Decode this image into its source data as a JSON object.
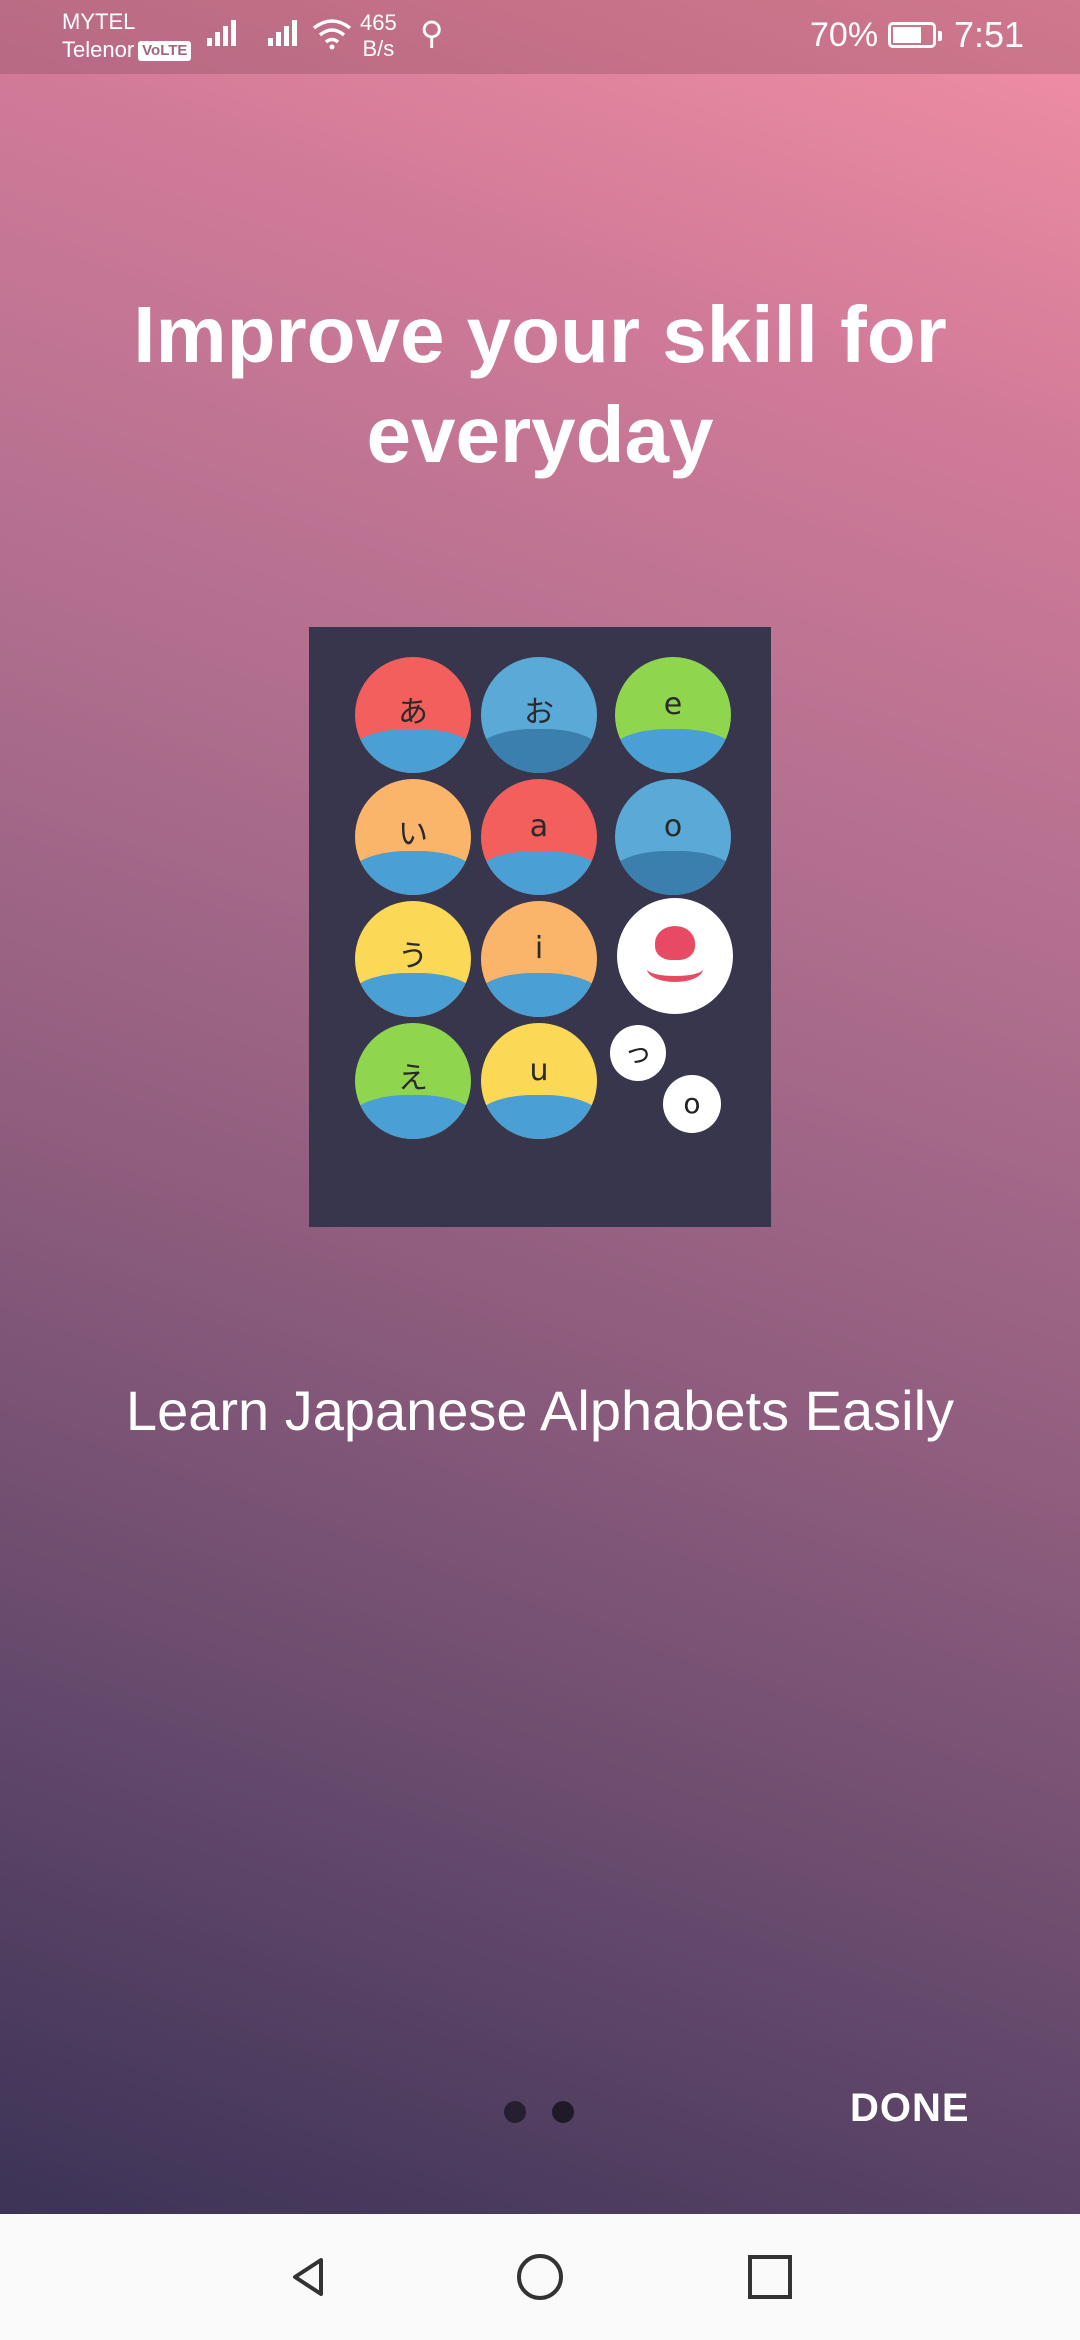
{
  "status_bar": {
    "carrier_1": "MYTEL",
    "carrier_2": "Telenor",
    "volte": "VoLTE",
    "speed_value": "465",
    "speed_unit": "B/s",
    "battery_percent": "70%",
    "time": "7:51"
  },
  "onboarding": {
    "headline": "Improve your skill for everyday",
    "subtitle": "Learn Japanese Alphabets Easily",
    "done_label": "DONE",
    "page_count": 2,
    "current_page": 2
  },
  "illustration": {
    "bubbles": [
      {
        "glyph": "あ",
        "color": "#f25f5c"
      },
      {
        "glyph": "お",
        "color": "#5aa9d6"
      },
      {
        "glyph": "e",
        "color": "#8fd64e"
      },
      {
        "glyph": "い",
        "color": "#fbb56b"
      },
      {
        "glyph": "a",
        "color": "#f25f5c"
      },
      {
        "glyph": "o",
        "color": "#5aa9d6"
      },
      {
        "glyph": "う",
        "color": "#fbd856"
      },
      {
        "glyph": "i",
        "color": "#fbb56b"
      },
      {
        "glyph": "え",
        "color": "#8fd64e"
      },
      {
        "glyph": "u",
        "color": "#fbd856"
      }
    ],
    "small_bubbles": [
      "っ",
      "o"
    ]
  },
  "colors": {
    "illustration_bg": "#37364d",
    "dot": "#1e1a2a"
  }
}
